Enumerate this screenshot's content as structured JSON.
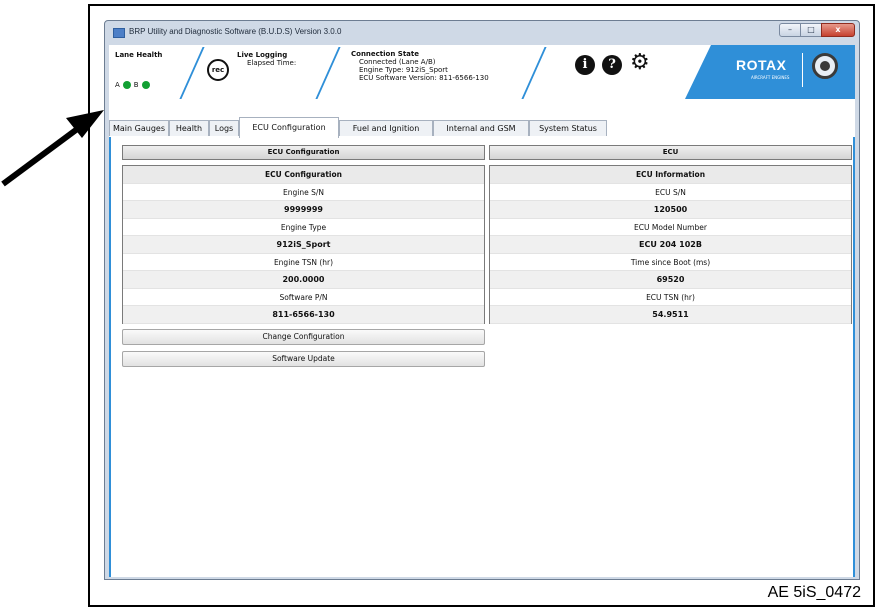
{
  "window": {
    "title": "BRP Utility and Diagnostic Software (B.U.D.S) Version 3.0.0",
    "controls": {
      "minimize": "–",
      "maximize": "□",
      "close": "x"
    }
  },
  "header": {
    "lane_health": {
      "title": "Lane Health",
      "lane_a": "A",
      "lane_b": "B"
    },
    "rec_label": "rec",
    "live_logging": {
      "title": "Live Logging",
      "elapsed_label": "Elapsed Time:"
    },
    "connection_state": {
      "title": "Connection State",
      "status": "Connected (Lane A/B)",
      "engine_type": "Engine Type: 912iS_Sport",
      "ecu_sw": "ECU Software Version: 811-6566-130"
    },
    "brand": {
      "name": "ROTAX",
      "subtitle": "AIRCRAFT ENGINES"
    },
    "colors": {
      "accent": "#2f8fd8",
      "lane_ok": "#12a033"
    },
    "icons": [
      "info-icon",
      "help-icon",
      "settings-gear-icon"
    ]
  },
  "tabs": [
    {
      "label": "Main Gauges"
    },
    {
      "label": "Health"
    },
    {
      "label": "Logs"
    },
    {
      "label": "ECU Configuration",
      "active": true
    },
    {
      "label": "Fuel and Ignition"
    },
    {
      "label": "Internal and GSM"
    },
    {
      "label": "System Status"
    }
  ],
  "ecu_configuration": {
    "section_title": "ECU Configuration",
    "panel_header": "ECU Configuration",
    "rows": [
      {
        "label": "Engine S/N",
        "value": "9999999"
      },
      {
        "label": "Engine Type",
        "value": "912iS_Sport"
      },
      {
        "label": "Engine TSN (hr)",
        "value": "200.0000"
      },
      {
        "label": "Software P/N",
        "value": "811-6566-130"
      }
    ],
    "buttons": {
      "change": "Change Configuration",
      "update": "Software Update"
    }
  },
  "ecu": {
    "section_title": "ECU",
    "panel_header": "ECU Information",
    "rows": [
      {
        "label": "ECU S/N",
        "value": "120500"
      },
      {
        "label": "ECU Model Number",
        "value": "ECU 204 102B"
      },
      {
        "label": "Time since Boot (ms)",
        "value": "69520"
      },
      {
        "label": "ECU TSN (hr)",
        "value": "54.9511"
      }
    ]
  },
  "figure_id": "AE 5iS_0472"
}
